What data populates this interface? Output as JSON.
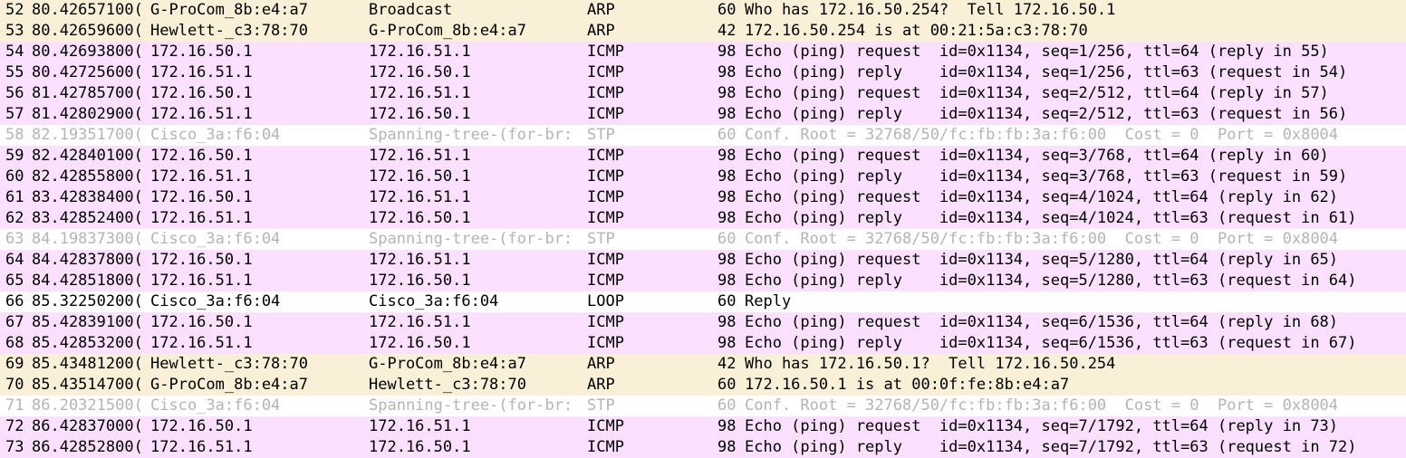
{
  "colors": {
    "arp": "#faf0d7",
    "icmp": "#fce0ff",
    "stp_text": "#b4b4b4",
    "default": "#ffffff"
  },
  "packets": [
    {
      "no": "52",
      "time": "80.42657100(",
      "source": "G-ProCom_8b:e4:a7",
      "destination": "Broadcast",
      "protocol": "ARP",
      "length": "60",
      "info": "Who has 172.16.50.254?  Tell 172.16.50.1",
      "style": "arp"
    },
    {
      "no": "53",
      "time": "80.42659600(",
      "source": "Hewlett-_c3:78:70",
      "destination": "G-ProCom_8b:e4:a7",
      "protocol": "ARP",
      "length": "42",
      "info": "172.16.50.254 is at 00:21:5a:c3:78:70",
      "style": "arp"
    },
    {
      "no": "54",
      "time": "80.42693800(",
      "source": "172.16.50.1",
      "destination": "172.16.51.1",
      "protocol": "ICMP",
      "length": "98",
      "info": "Echo (ping) request  id=0x1134, seq=1/256, ttl=64 (reply in 55)",
      "style": "icmp"
    },
    {
      "no": "55",
      "time": "80.42725600(",
      "source": "172.16.51.1",
      "destination": "172.16.50.1",
      "protocol": "ICMP",
      "length": "98",
      "info": "Echo (ping) reply    id=0x1134, seq=1/256, ttl=63 (request in 54)",
      "style": "icmp"
    },
    {
      "no": "56",
      "time": "81.42785700(",
      "source": "172.16.50.1",
      "destination": "172.16.51.1",
      "protocol": "ICMP",
      "length": "98",
      "info": "Echo (ping) request  id=0x1134, seq=2/512, ttl=64 (reply in 57)",
      "style": "icmp"
    },
    {
      "no": "57",
      "time": "81.42802900(",
      "source": "172.16.51.1",
      "destination": "172.16.50.1",
      "protocol": "ICMP",
      "length": "98",
      "info": "Echo (ping) reply    id=0x1134, seq=2/512, ttl=63 (request in 56)",
      "style": "icmp"
    },
    {
      "no": "58",
      "time": "82.19351700(",
      "source": "Cisco_3a:f6:04",
      "destination": "Spanning-tree-(for-br:",
      "protocol": "STP",
      "length": "60",
      "info": "Conf. Root = 32768/50/fc:fb:fb:3a:f6:00  Cost = 0  Port = 0x8004",
      "style": "stp"
    },
    {
      "no": "59",
      "time": "82.42840100(",
      "source": "172.16.50.1",
      "destination": "172.16.51.1",
      "protocol": "ICMP",
      "length": "98",
      "info": "Echo (ping) request  id=0x1134, seq=3/768, ttl=64 (reply in 60)",
      "style": "icmp"
    },
    {
      "no": "60",
      "time": "82.42855800(",
      "source": "172.16.51.1",
      "destination": "172.16.50.1",
      "protocol": "ICMP",
      "length": "98",
      "info": "Echo (ping) reply    id=0x1134, seq=3/768, ttl=63 (request in 59)",
      "style": "icmp"
    },
    {
      "no": "61",
      "time": "83.42838400(",
      "source": "172.16.50.1",
      "destination": "172.16.51.1",
      "protocol": "ICMP",
      "length": "98",
      "info": "Echo (ping) request  id=0x1134, seq=4/1024, ttl=64 (reply in 62)",
      "style": "icmp"
    },
    {
      "no": "62",
      "time": "83.42852400(",
      "source": "172.16.51.1",
      "destination": "172.16.50.1",
      "protocol": "ICMP",
      "length": "98",
      "info": "Echo (ping) reply    id=0x1134, seq=4/1024, ttl=63 (request in 61)",
      "style": "icmp"
    },
    {
      "no": "63",
      "time": "84.19837300(",
      "source": "Cisco_3a:f6:04",
      "destination": "Spanning-tree-(for-br:",
      "protocol": "STP",
      "length": "60",
      "info": "Conf. Root = 32768/50/fc:fb:fb:3a:f6:00  Cost = 0  Port = 0x8004",
      "style": "stp"
    },
    {
      "no": "64",
      "time": "84.42837800(",
      "source": "172.16.50.1",
      "destination": "172.16.51.1",
      "protocol": "ICMP",
      "length": "98",
      "info": "Echo (ping) request  id=0x1134, seq=5/1280, ttl=64 (reply in 65)",
      "style": "icmp"
    },
    {
      "no": "65",
      "time": "84.42851800(",
      "source": "172.16.51.1",
      "destination": "172.16.50.1",
      "protocol": "ICMP",
      "length": "98",
      "info": "Echo (ping) reply    id=0x1134, seq=5/1280, ttl=63 (request in 64)",
      "style": "icmp"
    },
    {
      "no": "66",
      "time": "85.32250200(",
      "source": "Cisco_3a:f6:04",
      "destination": "Cisco_3a:f6:04",
      "protocol": "LOOP",
      "length": "60",
      "info": "Reply",
      "style": "loop"
    },
    {
      "no": "67",
      "time": "85.42839100(",
      "source": "172.16.50.1",
      "destination": "172.16.51.1",
      "protocol": "ICMP",
      "length": "98",
      "info": "Echo (ping) request  id=0x1134, seq=6/1536, ttl=64 (reply in 68)",
      "style": "icmp"
    },
    {
      "no": "68",
      "time": "85.42853200(",
      "source": "172.16.51.1",
      "destination": "172.16.50.1",
      "protocol": "ICMP",
      "length": "98",
      "info": "Echo (ping) reply    id=0x1134, seq=6/1536, ttl=63 (request in 67)",
      "style": "icmp"
    },
    {
      "no": "69",
      "time": "85.43481200(",
      "source": "Hewlett-_c3:78:70",
      "destination": "G-ProCom_8b:e4:a7",
      "protocol": "ARP",
      "length": "42",
      "info": "Who has 172.16.50.1?  Tell 172.16.50.254",
      "style": "arp"
    },
    {
      "no": "70",
      "time": "85.43514700(",
      "source": "G-ProCom_8b:e4:a7",
      "destination": "Hewlett-_c3:78:70",
      "protocol": "ARP",
      "length": "60",
      "info": "172.16.50.1 is at 00:0f:fe:8b:e4:a7",
      "style": "arp"
    },
    {
      "no": "71",
      "time": "86.20321500(",
      "source": "Cisco_3a:f6:04",
      "destination": "Spanning-tree-(for-br:",
      "protocol": "STP",
      "length": "60",
      "info": "Conf. Root = 32768/50/fc:fb:fb:3a:f6:00  Cost = 0  Port = 0x8004",
      "style": "stp"
    },
    {
      "no": "72",
      "time": "86.42837000(",
      "source": "172.16.50.1",
      "destination": "172.16.51.1",
      "protocol": "ICMP",
      "length": "98",
      "info": "Echo (ping) request  id=0x1134, seq=7/1792, ttl=64 (reply in 73)",
      "style": "icmp"
    },
    {
      "no": "73",
      "time": "86.42852800(",
      "source": "172.16.51.1",
      "destination": "172.16.50.1",
      "protocol": "ICMP",
      "length": "98",
      "info": "Echo (ping) reply    id=0x1134, seq=7/1792, ttl=63 (request in 72)",
      "style": "icmp"
    }
  ]
}
